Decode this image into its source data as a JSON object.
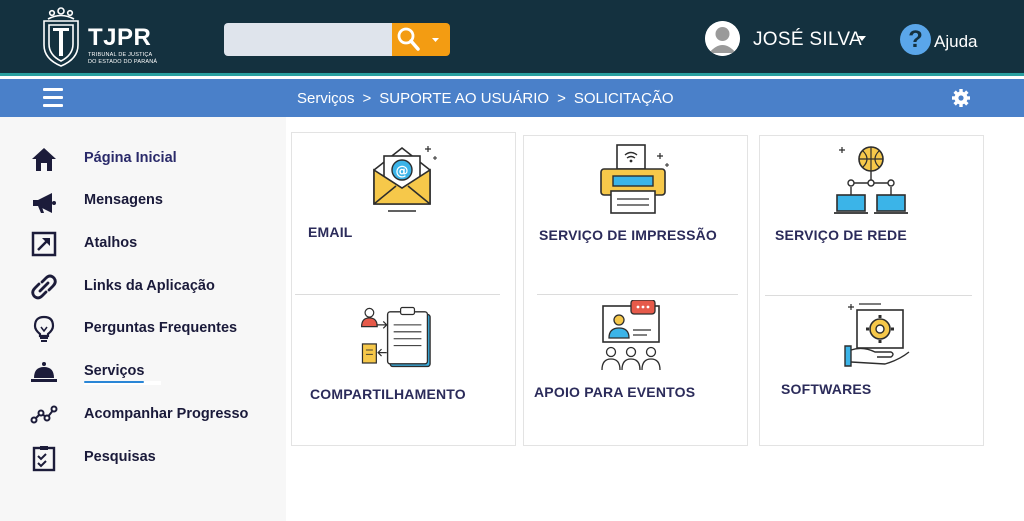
{
  "header": {
    "logo_text": "TJPR",
    "logo_sub1": "TRIBUNAL DE JUSTIÇA",
    "logo_sub2": "DO ESTADO DO PARANÁ",
    "search_placeholder": "",
    "user_name": "JOSÉ SILVA",
    "help_label": "Ajuda"
  },
  "breadcrumb": {
    "items": [
      "Serviços",
      "SUPORTE AO USUÁRIO",
      "SOLICITAÇÃO"
    ],
    "separator": ">"
  },
  "sidebar": {
    "items": [
      {
        "label": "Página Inicial",
        "icon": "home-icon"
      },
      {
        "label": "Mensagens",
        "icon": "megaphone-icon"
      },
      {
        "label": "Atalhos",
        "icon": "shortcut-icon"
      },
      {
        "label": "Links da Aplicação",
        "icon": "link-icon"
      },
      {
        "label": "Perguntas Frequentes",
        "icon": "lightbulb-icon"
      },
      {
        "label": "Serviços",
        "icon": "service-bell-icon"
      },
      {
        "label": "Acompanhar Progresso",
        "icon": "progress-icon"
      },
      {
        "label": "Pesquisas",
        "icon": "survey-icon"
      }
    ],
    "active": "Serviços"
  },
  "services": [
    {
      "label": "EMAIL",
      "icon": "email-icon"
    },
    {
      "label": "SERVIÇO DE IMPRESSÃO",
      "icon": "printer-icon"
    },
    {
      "label": "SERVIÇO DE REDE",
      "icon": "network-icon"
    },
    {
      "label": "COMPARTILHAMENTO",
      "icon": "sharing-icon"
    },
    {
      "label": "APOIO PARA EVENTOS",
      "icon": "events-icon"
    },
    {
      "label": "SOFTWARES",
      "icon": "software-icon"
    }
  ],
  "colors": {
    "header_bg": "#14313f",
    "navbar_bg": "#4a80c9",
    "search_button": "#f39c12",
    "accent_teal": "#2aa0a0"
  }
}
